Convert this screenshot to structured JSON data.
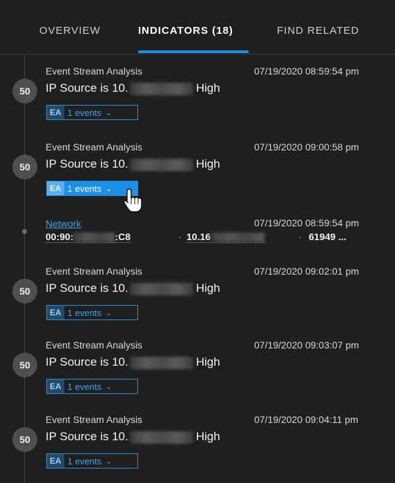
{
  "tabs": [
    {
      "label": "OVERVIEW"
    },
    {
      "label": "INDICATORS (18)"
    },
    {
      "label": "FIND RELATED"
    }
  ],
  "indicators": [
    {
      "score": "50",
      "source": "Event Stream Analysis",
      "timestamp": "07/19/2020 08:59:54 pm",
      "name_prefix": "IP Source is 10.",
      "name_suffix": "High",
      "tag": "EA",
      "events_label": "1 events"
    },
    {
      "score": "50",
      "source": "Event Stream Analysis",
      "timestamp": "07/19/2020 09:00:58 pm",
      "name_prefix": "IP Source is 10.",
      "name_suffix": "High",
      "tag": "EA",
      "events_label": "1 events"
    },
    {
      "score": "50",
      "source": "Event Stream Analysis",
      "timestamp": "07/19/2020 09:02:01 pm",
      "name_prefix": "IP Source is 10.",
      "name_suffix": "High",
      "tag": "EA",
      "events_label": "1 events"
    },
    {
      "score": "50",
      "source": "Event Stream Analysis",
      "timestamp": "07/19/2020 09:03:07 pm",
      "name_prefix": "IP Source is 10.",
      "name_suffix": "High",
      "tag": "EA",
      "events_label": "1 events"
    },
    {
      "score": "50",
      "source": "Event Stream Analysis",
      "timestamp": "07/19/2020 09:04:11 pm",
      "name_prefix": "IP Source is 10.",
      "name_suffix": "High",
      "tag": "EA",
      "events_label": "1 events"
    }
  ],
  "network_event": {
    "link": "Network",
    "timestamp": "07/19/2020 08:59:54 pm",
    "mac_prefix": "00:90:",
    "mac_suffix": ":C8",
    "ip_prefix": "10.16",
    "separator": "·",
    "port": "61949 ..."
  },
  "colors": {
    "accent": "#1e90e6",
    "background": "#1f1f1f",
    "score_bg": "#4f4f4f"
  },
  "icons": {
    "chevron": "chevron-down-icon",
    "cursor": "hand-pointer-icon"
  }
}
